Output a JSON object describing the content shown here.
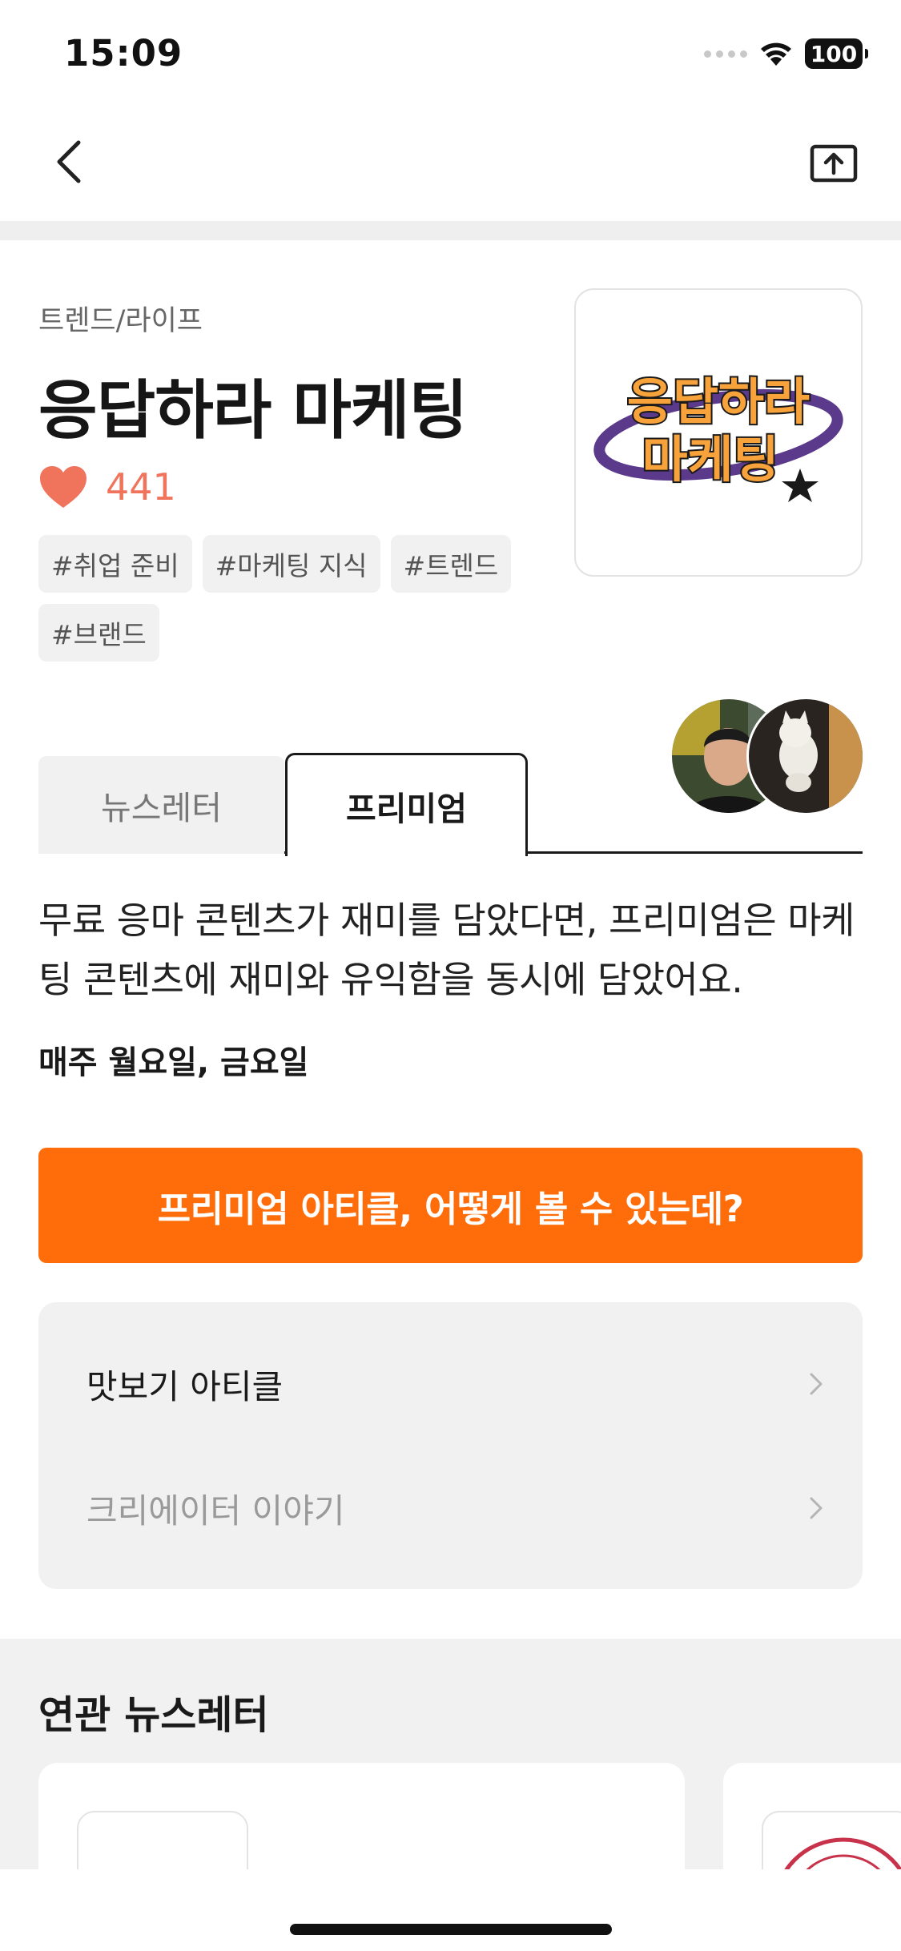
{
  "status_bar": {
    "time": "15:09",
    "battery": "100"
  },
  "nav": {
    "back_icon": "chevron-left-icon",
    "share_icon": "share-upload-icon"
  },
  "header": {
    "category": "트렌드/라이프",
    "title": "응답하라 마케팅",
    "likes": "441",
    "tags": [
      "#취업 준비",
      "#마케팅 지식",
      "#트렌드",
      "#브랜드"
    ],
    "logo_text": [
      "응답하라",
      "마케팅"
    ]
  },
  "tabs": [
    {
      "label": "뉴스레터",
      "selected": false
    },
    {
      "label": "프리미엄",
      "selected": true
    }
  ],
  "content": {
    "description": "무료 응마 콘텐츠가 재미를 담았다면, 프리미엄은 마케팅 콘텐츠에 재미와 유익함을 동시에 담았어요.",
    "schedule": "매주 월요일, 금요일",
    "cta_label": "프리미엄 아티클, 어떻게 볼 수 있는데?"
  },
  "menu": {
    "items": [
      {
        "label": "맛보기 아티클"
      },
      {
        "label": "크리에이터 이야기"
      }
    ]
  },
  "related": {
    "title": "연관 뉴스레터"
  },
  "colors": {
    "accent": "#ff6d0a",
    "heart": "#f0735c",
    "logo_orange": "#f7a23a",
    "logo_purple": "#5b3a8c"
  }
}
